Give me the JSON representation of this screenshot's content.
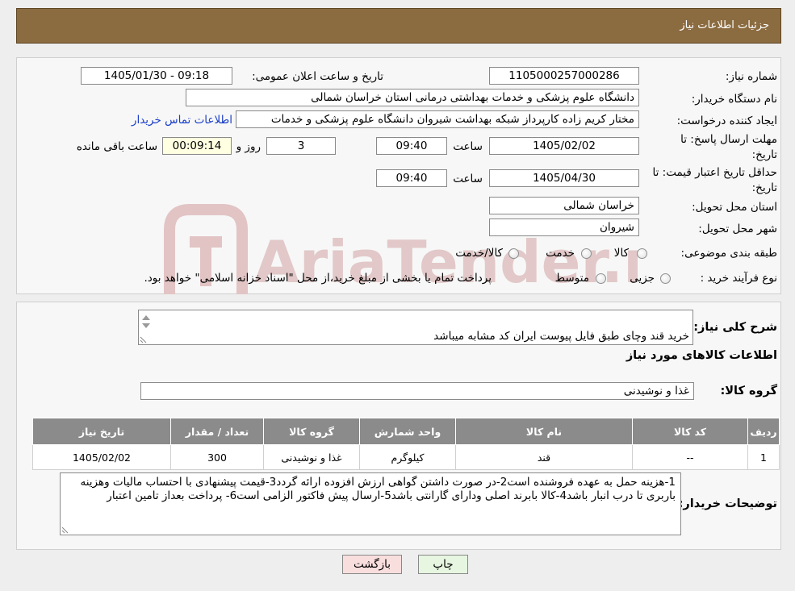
{
  "header": {
    "title": "جزئیات اطلاعات نیاز"
  },
  "watermark": {
    "text": "AriaTender.neT"
  },
  "fields": {
    "need_number_label": "شماره نیاز:",
    "need_number": "1105000257000286",
    "announce_label": "تاریخ و ساعت اعلان عمومی:",
    "announce_value": "1405/01/30 - 09:18",
    "buyer_label": "نام دستگاه خریدار:",
    "buyer_value": "دانشگاه علوم پزشکی و خدمات بهداشتی درمانی استان خراسان شمالی",
    "creator_label": "ایجاد کننده درخواست:",
    "creator_value": "مختار کریم زاده کارپرداز شبکه بهداشت شیروان دانشگاه علوم پزشکی و خدمات",
    "contact_link": "اطلاعات تماس خریدار",
    "deadline_label_1": "مهلت ارسال پاسخ: تا",
    "deadline_label_2": "تاریخ:",
    "deadline_date": "1405/02/02",
    "time_label": "ساعت",
    "deadline_time": "09:40",
    "days_value": "3",
    "days_label": "روز و",
    "remaining_time": "00:09:14",
    "remaining_label": "ساعت باقی مانده",
    "validity_label_1": "حداقل تاریخ اعتبار قیمت: تا",
    "validity_label_2": "تاریخ:",
    "validity_date": "1405/04/30",
    "validity_time_label": "ساعت",
    "validity_time": "09:40",
    "province_label": "استان محل تحویل:",
    "province_value": "خراسان شمالی",
    "city_label": "شهر محل تحویل:",
    "city_value": "شیروان",
    "category_label": "طبقه بندی موضوعی:",
    "category_options": [
      "کالا",
      "خدمت",
      "کالا/خدمت"
    ],
    "process_label": "نوع فرآیند خرید :",
    "process_options": [
      "جزیی",
      "متوسط"
    ],
    "process_note": "پرداخت تمام یا بخشی از مبلغ خرید،از محل \"اسناد خزانه اسلامی\" خواهد بود."
  },
  "description": {
    "label": "شرح کلی نیاز:",
    "value": "خرید قند وچای طبق فایل پیوست ایران کد مشابه میباشد"
  },
  "goods": {
    "section_title": "اطلاعات کالاهای مورد نیاز",
    "group_label": "گروه کالا:",
    "group_value": "غذا و نوشیدنی",
    "columns": [
      "ردیف",
      "کد کالا",
      "نام کالا",
      "واحد شمارش",
      "گروه کالا",
      "تعداد / مقدار",
      "تاریخ نیاز"
    ],
    "rows": [
      [
        "1",
        "--",
        "قند",
        "کیلوگرم",
        "غذا و نوشیدنی",
        "300",
        "1405/02/02"
      ]
    ]
  },
  "buyer_notes": {
    "label": "توضیحات خریدار:",
    "value": "1-هزینه حمل به عهده فروشنده است2-در صورت داشتن گواهی ارزش افزوده ارائه گردد3-قیمت پیشنهادی با احتساب مالیات وهزینه باربری تا درب انبار  باشد4-کالا بابرند اصلی ودارای گارانتی باشد5-ارسال پیش فاکتور الزامی است6- پرداخت بعداز تامین اعتبار"
  },
  "buttons": {
    "print": "چاپ",
    "back": "بازگشت"
  },
  "colors": {
    "header_bg": "#8b6b40",
    "table_header_bg": "#8b8b8b",
    "link": "#1a3ec8",
    "back_button_bg": "#f9dede",
    "print_button_bg": "#e6f6e0",
    "remaining_bg": "#ffffe1"
  }
}
